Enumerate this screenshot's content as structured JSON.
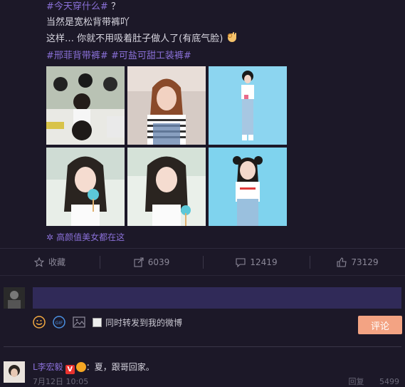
{
  "post": {
    "line1_topic": "#今天穿什么#",
    "line1_rest": "？",
    "line2": "当然是宽松背带裤吖",
    "line3": "这样… 你就不用吸着肚子做人了(有底气脸)",
    "line4_topic1": "#邢菲背带裤#",
    "line4_topic2": "#可盐可甜工装裤#"
  },
  "album": {
    "label": "高颜值美女都在这"
  },
  "actions": {
    "favorite": "收藏",
    "forward_count": "6039",
    "comment_count": "12419",
    "like_count": "73129"
  },
  "composer": {
    "placeholder": "",
    "forward_option": "同时转发到我的微博",
    "submit": "评论"
  },
  "comment": {
    "user": "L李宏毅",
    "text": "：夏，跟哥回家。",
    "time": "7月12日 10:05",
    "reply": "回复",
    "likes": "5499"
  },
  "colors": {
    "bg": "#1c1828",
    "topic": "#8a70d8",
    "input": "#302a58",
    "submit": "#f3a383"
  }
}
